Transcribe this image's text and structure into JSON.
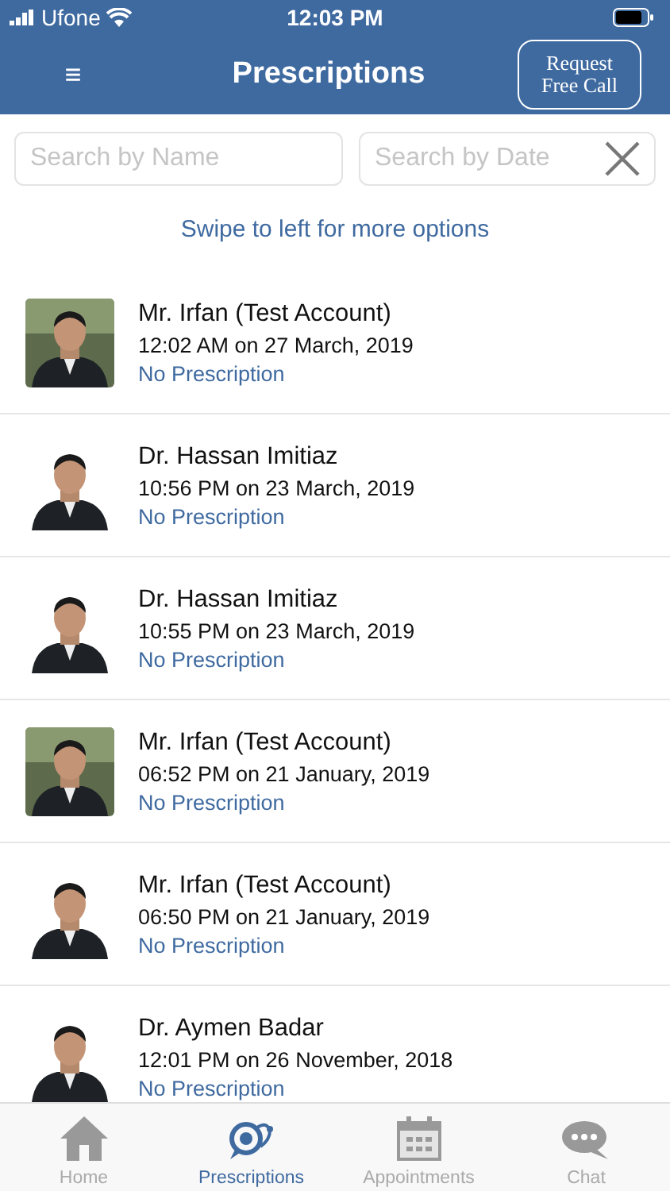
{
  "status_bar": {
    "carrier": "Ufone",
    "time": "12:03 PM"
  },
  "header": {
    "menu": "≡",
    "title": "Prescriptions",
    "action": "Request\nFree Call"
  },
  "search": {
    "name_placeholder": "Search by Name",
    "date_placeholder": "Search by Date"
  },
  "hint": "Swipe to left for more options",
  "prescriptions": [
    {
      "doctor": "Mr. Irfan (Test Account)",
      "time": "12:02 AM on 27 March, 2019",
      "status": "No Prescription"
    },
    {
      "doctor": "Dr. Hassan Imitiaz",
      "time": "10:56 PM on 23 March, 2019",
      "status": "No Prescription"
    },
    {
      "doctor": "Dr. Hassan Imitiaz",
      "time": "10:55 PM on 23 March, 2019",
      "status": "No Prescription"
    },
    {
      "doctor": "Mr. Irfan (Test Account)",
      "time": "06:52 PM on 21 January, 2019",
      "status": "No Prescription"
    },
    {
      "doctor": "Mr. Irfan (Test Account)",
      "time": "06:50 PM on 21 January, 2019",
      "status": "No Prescription"
    },
    {
      "doctor": "Dr. Aymen Badar",
      "time": "12:01 PM on 26 November, 2018",
      "status": "No Prescription"
    }
  ],
  "tabs": [
    {
      "kind": "home",
      "label": "Home",
      "selected": false
    },
    {
      "kind": "prescriptions",
      "label": "Prescriptions",
      "selected": true
    },
    {
      "kind": "appointments",
      "label": "Appointments",
      "selected": false
    },
    {
      "kind": "chat",
      "label": "Chat",
      "selected": false
    }
  ]
}
